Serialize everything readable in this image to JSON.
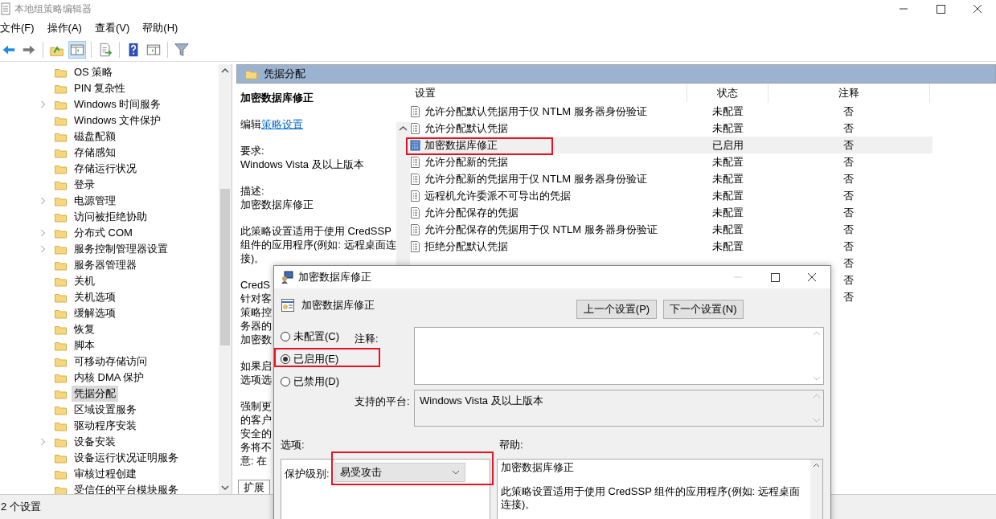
{
  "window": {
    "title": "本地组策略编辑器"
  },
  "menu": [
    "文件(F)",
    "操作(A)",
    "查看(V)",
    "帮助(H)"
  ],
  "toolbar": [
    {
      "kind": "back",
      "pressed": false
    },
    {
      "kind": "forward",
      "pressed": false
    },
    {
      "kind": "sep"
    },
    {
      "kind": "up",
      "pressed": false
    },
    {
      "kind": "tree",
      "pressed": true
    },
    {
      "kind": "sep"
    },
    {
      "kind": "export",
      "pressed": false
    },
    {
      "kind": "sep"
    },
    {
      "kind": "help",
      "pressed": false
    },
    {
      "kind": "pane",
      "pressed": false
    },
    {
      "kind": "sep"
    },
    {
      "kind": "filter",
      "pressed": false
    }
  ],
  "tree": {
    "items": [
      {
        "label": "OS 策略",
        "expandable": false,
        "selected": false
      },
      {
        "label": "PIN 复杂性",
        "expandable": false,
        "selected": false
      },
      {
        "label": "Windows 时间服务",
        "expandable": true,
        "selected": false
      },
      {
        "label": "Windows 文件保护",
        "expandable": false,
        "selected": false
      },
      {
        "label": "磁盘配额",
        "expandable": false,
        "selected": false
      },
      {
        "label": "存储感知",
        "expandable": false,
        "selected": false
      },
      {
        "label": "存储运行状况",
        "expandable": false,
        "selected": false
      },
      {
        "label": "登录",
        "expandable": false,
        "selected": false
      },
      {
        "label": "电源管理",
        "expandable": true,
        "selected": false
      },
      {
        "label": "访问被拒绝协助",
        "expandable": false,
        "selected": false
      },
      {
        "label": "分布式 COM",
        "expandable": true,
        "selected": false
      },
      {
        "label": "服务控制管理器设置",
        "expandable": true,
        "selected": false
      },
      {
        "label": "服务器管理器",
        "expandable": false,
        "selected": false
      },
      {
        "label": "关机",
        "expandable": false,
        "selected": false
      },
      {
        "label": "关机选项",
        "expandable": false,
        "selected": false
      },
      {
        "label": "缓解选项",
        "expandable": false,
        "selected": false
      },
      {
        "label": "恢复",
        "expandable": false,
        "selected": false
      },
      {
        "label": "脚本",
        "expandable": false,
        "selected": false
      },
      {
        "label": "可移动存储访问",
        "expandable": false,
        "selected": false
      },
      {
        "label": "内核 DMA 保护",
        "expandable": false,
        "selected": false
      },
      {
        "label": "凭据分配",
        "expandable": false,
        "selected": true
      },
      {
        "label": "区域设置服务",
        "expandable": false,
        "selected": false
      },
      {
        "label": "驱动程序安装",
        "expandable": false,
        "selected": false
      },
      {
        "label": "设备安装",
        "expandable": true,
        "selected": false
      },
      {
        "label": "设备运行状况证明服务",
        "expandable": false,
        "selected": false
      },
      {
        "label": "审核过程创建",
        "expandable": false,
        "selected": false
      },
      {
        "label": "受信任的平台模块服务",
        "expandable": false,
        "selected": false
      }
    ]
  },
  "pane_header": "凭据分配",
  "description": {
    "title": "加密数据库修正",
    "edit_prefix": "编辑",
    "edit_link": "策略设置",
    "paragraphs": [
      [
        "要求:",
        "Windows Vista 及以上版本"
      ],
      [
        "描述:",
        "加密数据库修正"
      ],
      [
        "此策略设置适用于使用 CredSSP",
        "组件的应用程序(例如: 远程桌面连",
        "接)。"
      ],
      [
        "CredS",
        "针对客",
        "策略控",
        "务器的",
        "加密数"
      ],
      [
        "如果启",
        "选项选"
      ],
      [
        "强制更",
        "的客户",
        "安全的",
        "务将不",
        "意: 在"
      ]
    ]
  },
  "bottom_tabs": [
    {
      "label": "扩展",
      "selected": true
    }
  ],
  "table": {
    "columns": [
      "设置",
      "状态",
      "注释"
    ],
    "rows": [
      {
        "name": "允许分配默认凭据用于仅 NTLM 服务器身份验证",
        "status": "未配置",
        "note": "否",
        "selected": false,
        "highlighted": false
      },
      {
        "name": "允许分配默认凭据",
        "status": "未配置",
        "note": "否",
        "selected": false,
        "highlighted": false
      },
      {
        "name": "加密数据库修正",
        "status": "已启用",
        "note": "否",
        "selected": true,
        "highlighted": true
      },
      {
        "name": "允许分配新的凭据",
        "status": "未配置",
        "note": "否",
        "selected": false,
        "highlighted": false
      },
      {
        "name": "允许分配新的凭据用于仅 NTLM 服务器身份验证",
        "status": "未配置",
        "note": "否",
        "selected": false,
        "highlighted": false
      },
      {
        "name": "远程机允许委派不可导出的凭据",
        "status": "未配置",
        "note": "否",
        "selected": false,
        "highlighted": false
      },
      {
        "name": "允许分配保存的凭据",
        "status": "未配置",
        "note": "否",
        "selected": false,
        "highlighted": false
      },
      {
        "name": "允许分配保存的凭据用于仅 NTLM 服务器身份验证",
        "status": "未配置",
        "note": "否",
        "selected": false,
        "highlighted": false
      },
      {
        "name": "拒绝分配默认凭据",
        "status": "未配置",
        "note": "否",
        "selected": false,
        "highlighted": false
      },
      {
        "note": "否",
        "selected": false,
        "highlighted": false
      },
      {
        "note": "否",
        "selected": false,
        "highlighted": false
      },
      {
        "note": "否",
        "selected": false,
        "highlighted": false
      }
    ]
  },
  "status_bar": "2 个设置",
  "dialog": {
    "title": "加密数据库修正",
    "heading": "加密数据库修正",
    "buttons": [
      "上一个设置(P)",
      "下一个设置(N)"
    ],
    "radios": [
      {
        "label": "未配置(C)",
        "selected": false,
        "highlighted": false
      },
      {
        "label": "已启用(E)",
        "selected": true,
        "highlighted": true
      },
      {
        "label": "已禁用(D)",
        "selected": false,
        "highlighted": false
      }
    ],
    "comment_label": "注释:",
    "platform_label": "支持的平台:",
    "platform": "Windows Vista 及以上版本",
    "options_label": "选项:",
    "help_label": "帮助:",
    "option": {
      "label": "保护级别:",
      "value": "易受攻击",
      "highlighted": true
    },
    "help": [
      "加密数据库修正",
      "此策略设置适用于使用 CredSSP 组件的应用程序(例如: 远程桌面连接)。"
    ]
  }
}
